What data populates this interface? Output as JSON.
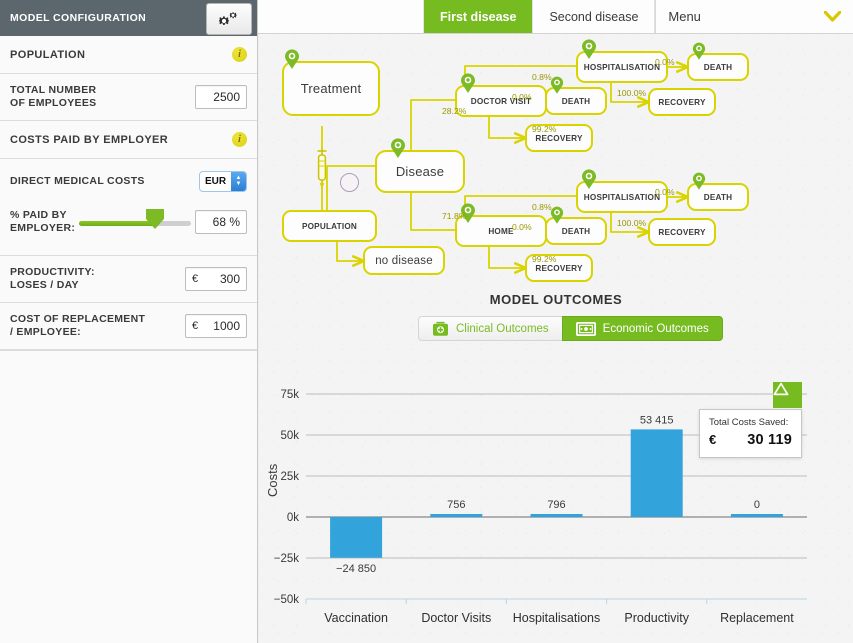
{
  "sidebar": {
    "header_title": "MODEL CONFIGURATION",
    "gear_icon": "double-gear-icon",
    "sections": {
      "population_label": "POPULATION",
      "population_info_icon": "info-icon",
      "total_employees_label": "TOTAL NUMBER\nOF EMPLOYEES",
      "total_employees_line1": "TOTAL NUMBER",
      "total_employees_line2": "OF EMPLOYEES",
      "total_employees_value": "2500",
      "costs_label": "COSTS PAID BY EMPLOYER",
      "costs_info_icon": "info-icon",
      "direct_medical_label": "DIRECT MEDICAL COSTS",
      "currency_value": "EUR",
      "currency_options": "EUR",
      "pct_label_line1": "% PAID BY",
      "pct_label_line2": "EMPLOYER:",
      "pct_value": "68 %",
      "pct_number": 68,
      "productivity_line1": "PRODUCTIVITY:",
      "productivity_line2": "LOSES / DAY",
      "productivity_symbol": "€",
      "productivity_value": "300",
      "replacement_line1": "COST OF REPLACEMENT",
      "replacement_line2": "/ EMPLOYEE:",
      "replacement_symbol": "€",
      "replacement_value": "1000"
    }
  },
  "topbar": {
    "tab_first": "First disease",
    "tab_second": "Second disease",
    "menu_label": "Menu",
    "menu_icon": "chevron-down-icon"
  },
  "diagram": {
    "nodes": {
      "treatment": "Treatment",
      "population": "POPULATION",
      "no_disease": "no disease",
      "disease": "Disease",
      "doctor_visit": "DOCTOR VISIT",
      "home": "HOME",
      "hospitalisation_top": "HOSPITALISATION",
      "hospitalisation_bottom": "HOSPITALISATION",
      "death_dv_top": "DEATH",
      "death_dv_mid": "DEATH",
      "recovery_dv": "RECOVERY",
      "recovery_hosp_top": "RECOVERY",
      "death_home_top": "DEATH",
      "death_home_mid": "DEATH",
      "recovery_home": "RECOVERY",
      "recovery_hosp_bottom": "RECOVERY"
    },
    "edge_labels": {
      "disease_to_doctor": "28.2%",
      "disease_to_home": "71.8%",
      "doctor_to_hosp": "0.8%",
      "doctor_to_death": "0.0%",
      "doctor_to_recovery": "99.2%",
      "hosp_top_to_death": "0.0%",
      "hosp_top_to_recovery": "100.0%",
      "home_to_hosp": "0.8%",
      "home_to_death": "0.0%",
      "home_to_recovery": "99.2%",
      "hosp_bottom_to_death": "0.0%",
      "hosp_bottom_to_recovery": "100.0%"
    },
    "icons": {
      "gear_pin": "gear-pin-icon",
      "syringe": "syringe-icon",
      "virus_circle": "virus-circle-icon"
    }
  },
  "outcomes": {
    "title": "MODEL OUTCOMES",
    "tab_clinical": "Clinical Outcomes",
    "tab_clinical_icon": "medical-bag-icon",
    "tab_economic": "Economic Outcomes",
    "tab_economic_icon": "banknote-icon",
    "triangle_icon": "triangle-up-icon",
    "tooltip_title": "Total Costs Saved:",
    "tooltip_symbol": "€",
    "tooltip_amount": "30 119"
  },
  "colors": {
    "accent_green": "#76bc21",
    "bar_blue": "#33a3dc",
    "node_yellow": "#d9d400",
    "header_grey": "#5b676d",
    "info_yellow": "#ddd015"
  },
  "chart_data": {
    "type": "bar",
    "title": "",
    "xlabel": "",
    "ylabel": "Costs",
    "categories": [
      "Vaccination",
      "Doctor Visits",
      "Hospitalisations",
      "Productivity",
      "Replacement"
    ],
    "values": [
      -24850,
      756,
      796,
      53415,
      0
    ],
    "value_labels": [
      "−24 850",
      "756",
      "796",
      "53 415",
      "0"
    ],
    "ylim": [
      -50000,
      75000
    ],
    "yticks": [
      75000,
      50000,
      25000,
      0,
      -25000,
      -50000
    ],
    "ytick_labels": [
      "75k",
      "50k",
      "25k",
      "0k",
      "−25k",
      "−50k"
    ],
    "grid": true,
    "legend": false,
    "series_color": "#33a3dc"
  }
}
